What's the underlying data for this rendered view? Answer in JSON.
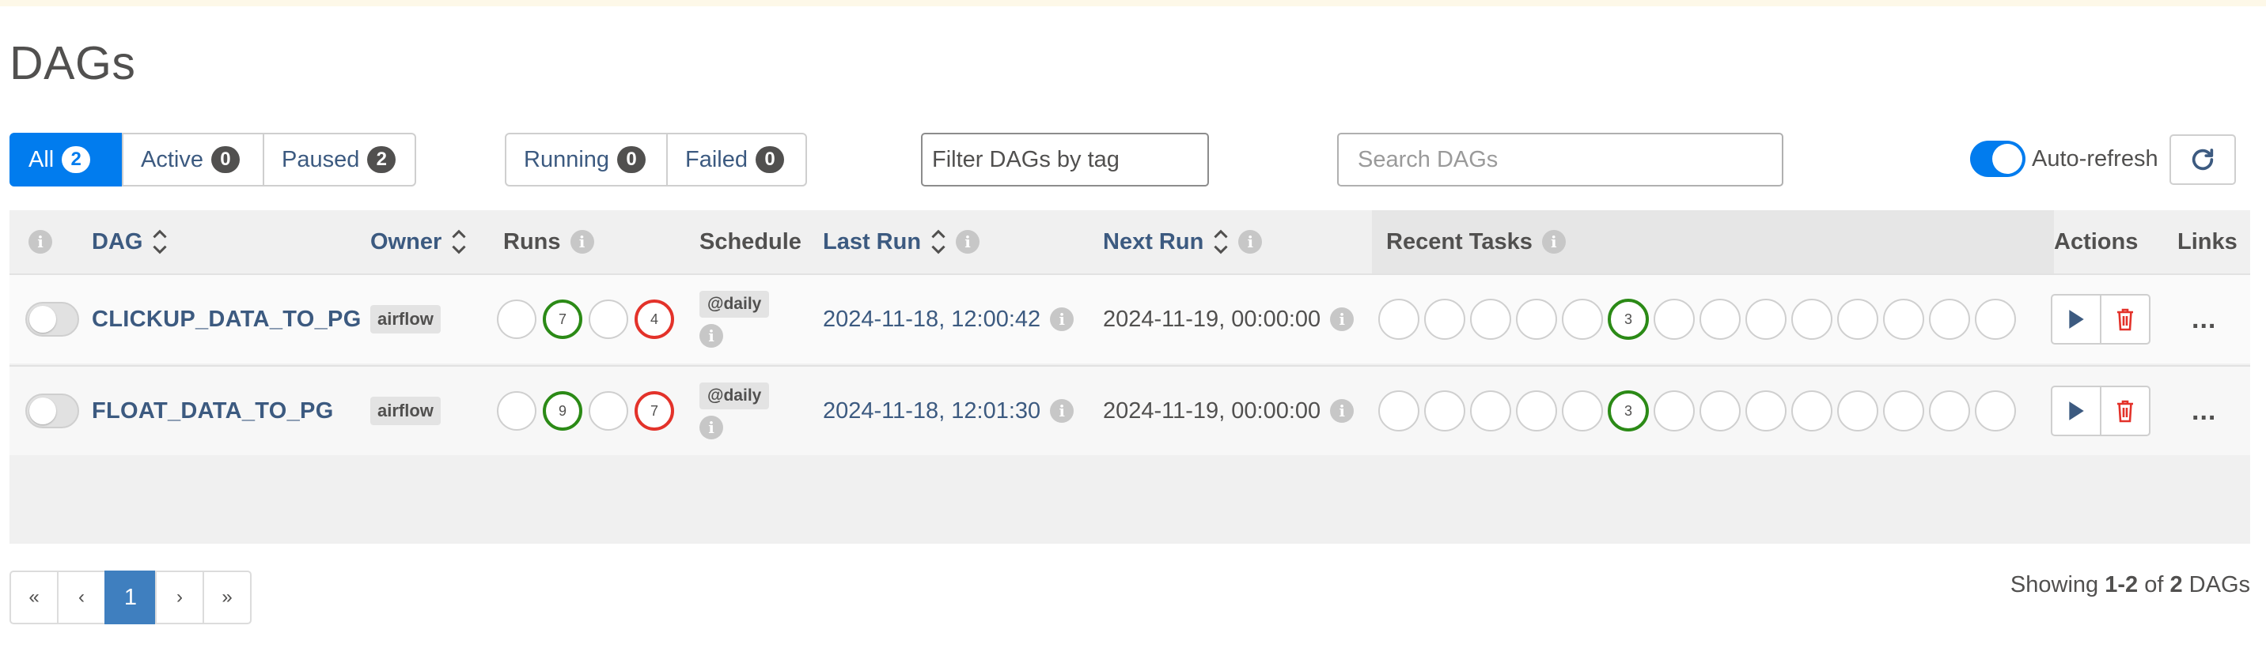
{
  "page": {
    "title": "DAGs"
  },
  "status_filter": [
    {
      "label": "All",
      "count": "2"
    },
    {
      "label": "Active",
      "count": "0"
    },
    {
      "label": "Paused",
      "count": "2"
    }
  ],
  "run_filter": [
    {
      "label": "Running",
      "count": "0"
    },
    {
      "label": "Failed",
      "count": "0"
    }
  ],
  "tag_filter": {
    "placeholder": "Filter DAGs by tag"
  },
  "search": {
    "placeholder": "Search DAGs"
  },
  "auto_refresh": {
    "label": "Auto-refresh",
    "on": true
  },
  "table": {
    "headers": {
      "dag": "DAG",
      "owner": "Owner",
      "runs": "Runs",
      "schedule": "Schedule",
      "last_run": "Last Run",
      "next_run": "Next Run",
      "recent_tasks": "Recent Tasks",
      "actions": "Actions",
      "links": "Links"
    },
    "rows": [
      {
        "dag_id": "CLICKUP_DATA_TO_PG",
        "owner": "airflow",
        "runs": [
          "",
          "7",
          "",
          "4"
        ],
        "schedule": "@daily",
        "last_run": "2024-11-18, 12:00:42",
        "next_run": "2024-11-19, 00:00:00",
        "recent_tasks_success": "3",
        "links_label": "..."
      },
      {
        "dag_id": "FLOAT_DATA_TO_PG",
        "owner": "airflow",
        "runs": [
          "",
          "9",
          "",
          "7"
        ],
        "schedule": "@daily",
        "last_run": "2024-11-18, 12:01:30",
        "next_run": "2024-11-19, 00:00:00",
        "recent_tasks_success": "3",
        "links_label": "..."
      }
    ]
  },
  "pagination": {
    "first": "«",
    "prev": "‹",
    "current": "1",
    "next": "›",
    "last": "»"
  },
  "footer": {
    "showing_prefix": "Showing",
    "range": "1-2",
    "of": "of",
    "total": "2",
    "suffix": "DAGs"
  },
  "colors": {
    "accent": "#017cee",
    "link": "#3c5a80",
    "success": "#2b8a16",
    "failed": "#e3322a"
  }
}
